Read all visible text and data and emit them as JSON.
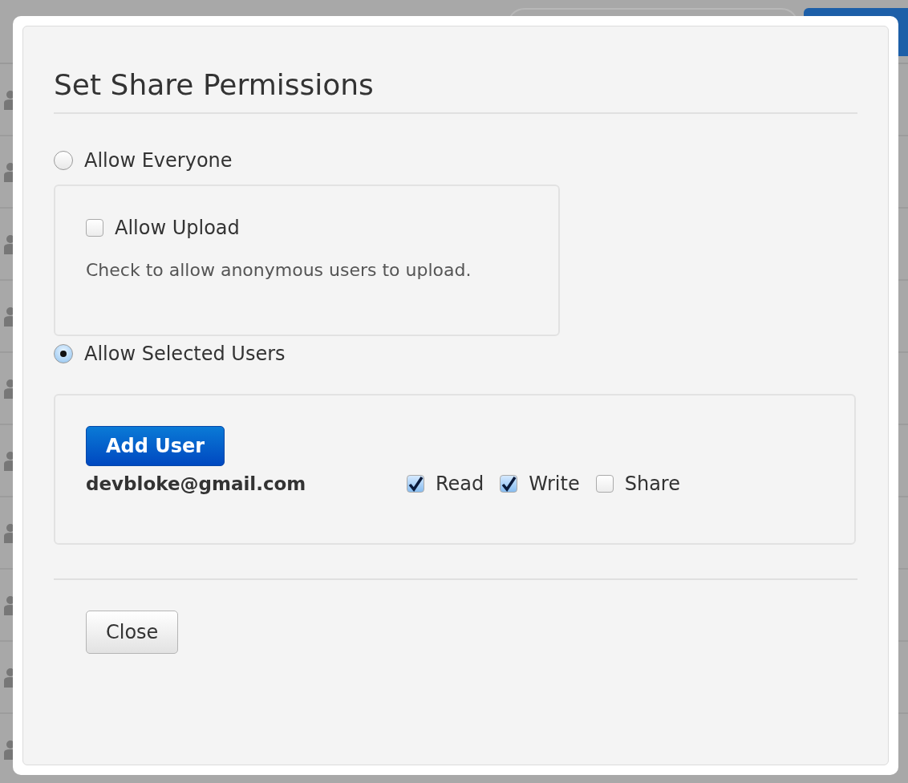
{
  "dialog": {
    "title": "Set Share Permissions",
    "options": [
      {
        "label": "Allow Everyone",
        "selected": false
      },
      {
        "label": "Allow Selected Users",
        "selected": true
      }
    ],
    "upload": {
      "label": "Allow Upload",
      "checked": false,
      "help": "Check to allow anonymous users to upload."
    },
    "add_button": "Add User",
    "users": [
      {
        "email": "devbloke@gmail.com",
        "permissions": [
          {
            "label": "Read",
            "checked": true
          },
          {
            "label": "Write",
            "checked": true
          },
          {
            "label": "Share",
            "checked": false
          }
        ]
      }
    ],
    "close_button": "Close"
  }
}
